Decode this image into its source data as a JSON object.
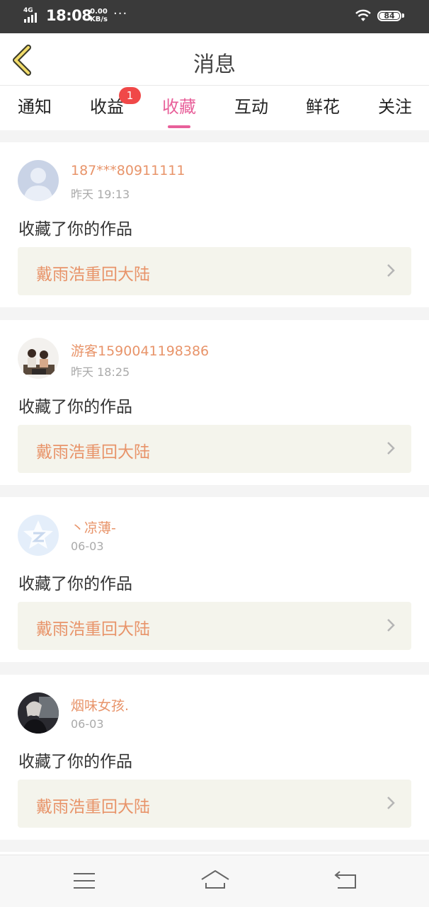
{
  "status_bar": {
    "network": "4G",
    "time": "18:08",
    "speed_value": "0.00",
    "speed_unit": "KB/s",
    "more": "···",
    "battery": "84"
  },
  "header": {
    "title": "消息"
  },
  "tabs": [
    {
      "label": "通知",
      "active": false
    },
    {
      "label": "收益",
      "active": false,
      "badge": "1"
    },
    {
      "label": "收藏",
      "active": true
    },
    {
      "label": "互动",
      "active": false
    },
    {
      "label": "鲜花",
      "active": false
    },
    {
      "label": "关注",
      "active": false
    }
  ],
  "colors": {
    "accent": "#e8609a",
    "name": "#e8946a",
    "badge": "#f04848"
  },
  "notifications": [
    {
      "user": "187***80911111",
      "time": "昨天 19:13",
      "action": "收藏了你的作品",
      "work": "戴雨浩重回大陆",
      "avatar": "default-person-avatar"
    },
    {
      "user": "游客1590041198386",
      "time": "昨天 18:25",
      "action": "收藏了你的作品",
      "work": "戴雨浩重回大陆",
      "avatar": "children-photo-avatar"
    },
    {
      "user": "丶凉薄-",
      "time": "06-03",
      "action": "收藏了你的作品",
      "work": "戴雨浩重回大陆",
      "avatar": "qzone-star-avatar"
    },
    {
      "user": "烟味女孩.",
      "time": "06-03",
      "action": "收藏了你的作品",
      "work": "戴雨浩重回大陆",
      "avatar": "girl-photo-avatar"
    }
  ]
}
